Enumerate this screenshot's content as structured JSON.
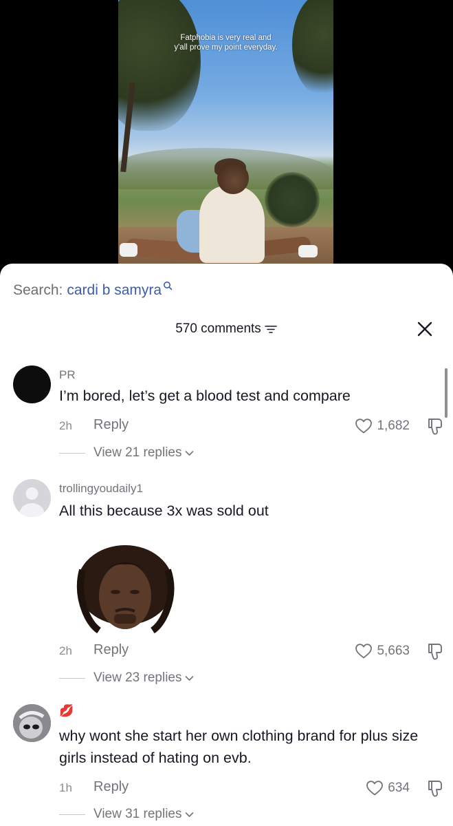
{
  "video": {
    "overlay_line1": "Fatphobia is very real and",
    "overlay_line2": "y'all prove my point everyday."
  },
  "search": {
    "prefix": "Search:",
    "query": "cardi b samyra"
  },
  "header": {
    "comment_count": "570 comments"
  },
  "comments": [
    {
      "username": "PR",
      "text": "I’m bored, let’s get a blood test and compare",
      "time": "2h",
      "reply_label": "Reply",
      "likes": "1,682",
      "view_replies": "View 21 replies"
    },
    {
      "username": "trollingyoudaily1",
      "text": "All this because 3x was sold out",
      "time": "2h",
      "reply_label": "Reply",
      "likes": "5,663",
      "view_replies": "View 23 replies"
    },
    {
      "username": "💋",
      "text": "why wont she start her own clothing brand for plus size girls instead of hating on evb.",
      "time": "1h",
      "reply_label": "Reply",
      "likes": "634",
      "view_replies": "View 31 replies"
    }
  ],
  "colors": {
    "accent_search": "#3b5dab",
    "text_primary": "#161823",
    "text_secondary": "#73747a"
  }
}
